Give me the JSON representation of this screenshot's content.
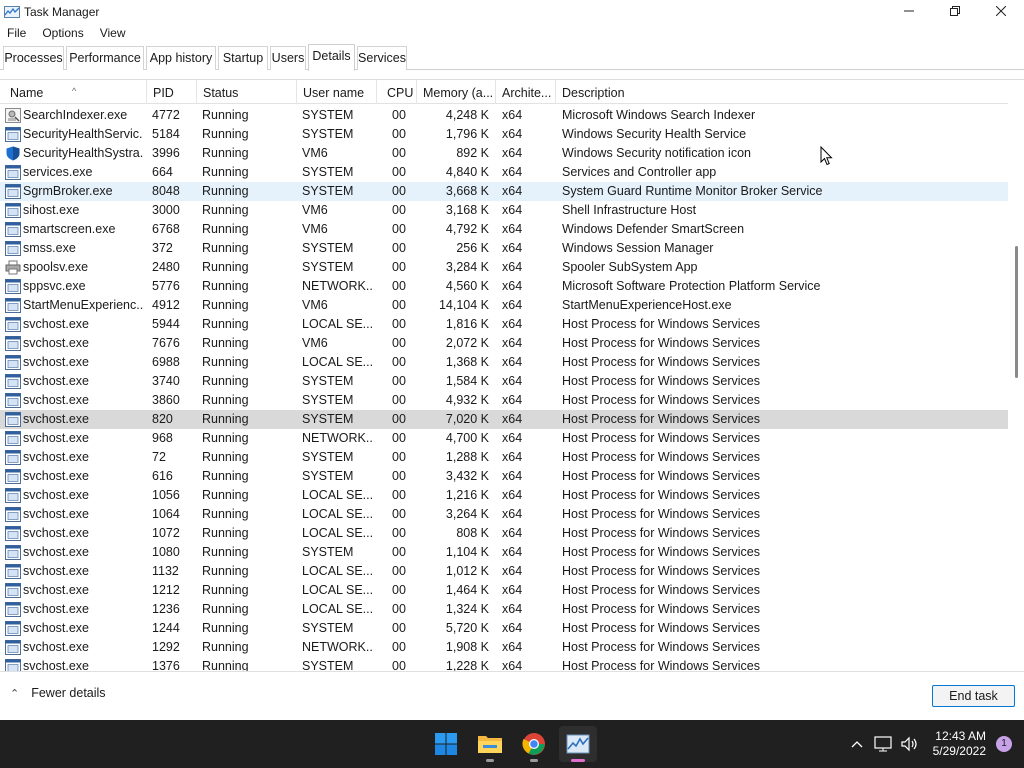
{
  "window": {
    "title": "Task Manager"
  },
  "menu": [
    "File",
    "Options",
    "View"
  ],
  "tabs": [
    {
      "label": "Processes",
      "active": false
    },
    {
      "label": "Performance",
      "active": false
    },
    {
      "label": "App history",
      "active": false
    },
    {
      "label": "Startup",
      "active": false
    },
    {
      "label": "Users",
      "active": false
    },
    {
      "label": "Details",
      "active": true
    },
    {
      "label": "Services",
      "active": false
    }
  ],
  "columns": {
    "name": "Name",
    "pid": "PID",
    "status": "Status",
    "user": "User name",
    "cpu": "CPU",
    "memory": "Memory (a...",
    "arch": "Archite...",
    "description": "Description"
  },
  "rows": [
    {
      "icon": "user-icon",
      "name": "SearchIndexer.exe",
      "pid": "4772",
      "status": "Running",
      "user": "SYSTEM",
      "cpu": "00",
      "mem": "4,248 K",
      "arch": "x64",
      "desc": "Microsoft Windows Search Indexer"
    },
    {
      "icon": "window-icon",
      "name": "SecurityHealthServic...",
      "pid": "5184",
      "status": "Running",
      "user": "SYSTEM",
      "cpu": "00",
      "mem": "1,796 K",
      "arch": "x64",
      "desc": "Windows Security Health Service"
    },
    {
      "icon": "shield-icon",
      "name": "SecurityHealthSystra...",
      "pid": "3996",
      "status": "Running",
      "user": "VM6",
      "cpu": "00",
      "mem": "892 K",
      "arch": "x64",
      "desc": "Windows Security notification icon"
    },
    {
      "icon": "window-icon",
      "name": "services.exe",
      "pid": "664",
      "status": "Running",
      "user": "SYSTEM",
      "cpu": "00",
      "mem": "4,840 K",
      "arch": "x64",
      "desc": "Services and Controller app"
    },
    {
      "icon": "window-icon",
      "name": "SgrmBroker.exe",
      "pid": "8048",
      "status": "Running",
      "user": "SYSTEM",
      "cpu": "00",
      "mem": "3,668 K",
      "arch": "x64",
      "desc": "System Guard Runtime Monitor Broker Service",
      "highlight": "blue"
    },
    {
      "icon": "window-icon",
      "name": "sihost.exe",
      "pid": "3000",
      "status": "Running",
      "user": "VM6",
      "cpu": "00",
      "mem": "3,168 K",
      "arch": "x64",
      "desc": "Shell Infrastructure Host"
    },
    {
      "icon": "window-icon",
      "name": "smartscreen.exe",
      "pid": "6768",
      "status": "Running",
      "user": "VM6",
      "cpu": "00",
      "mem": "4,792 K",
      "arch": "x64",
      "desc": "Windows Defender SmartScreen"
    },
    {
      "icon": "window-icon",
      "name": "smss.exe",
      "pid": "372",
      "status": "Running",
      "user": "SYSTEM",
      "cpu": "00",
      "mem": "256 K",
      "arch": "x64",
      "desc": "Windows Session Manager"
    },
    {
      "icon": "printer-icon",
      "name": "spoolsv.exe",
      "pid": "2480",
      "status": "Running",
      "user": "SYSTEM",
      "cpu": "00",
      "mem": "3,284 K",
      "arch": "x64",
      "desc": "Spooler SubSystem App"
    },
    {
      "icon": "window-icon",
      "name": "sppsvc.exe",
      "pid": "5776",
      "status": "Running",
      "user": "NETWORK...",
      "cpu": "00",
      "mem": "4,560 K",
      "arch": "x64",
      "desc": "Microsoft Software Protection Platform Service"
    },
    {
      "icon": "window-icon",
      "name": "StartMenuExperienc...",
      "pid": "4912",
      "status": "Running",
      "user": "VM6",
      "cpu": "00",
      "mem": "14,104 K",
      "arch": "x64",
      "desc": "StartMenuExperienceHost.exe"
    },
    {
      "icon": "window-icon",
      "name": "svchost.exe",
      "pid": "5944",
      "status": "Running",
      "user": "LOCAL SE...",
      "cpu": "00",
      "mem": "1,816 K",
      "arch": "x64",
      "desc": "Host Process for Windows Services"
    },
    {
      "icon": "window-icon",
      "name": "svchost.exe",
      "pid": "7676",
      "status": "Running",
      "user": "VM6",
      "cpu": "00",
      "mem": "2,072 K",
      "arch": "x64",
      "desc": "Host Process for Windows Services"
    },
    {
      "icon": "window-icon",
      "name": "svchost.exe",
      "pid": "6988",
      "status": "Running",
      "user": "LOCAL SE...",
      "cpu": "00",
      "mem": "1,368 K",
      "arch": "x64",
      "desc": "Host Process for Windows Services"
    },
    {
      "icon": "window-icon",
      "name": "svchost.exe",
      "pid": "3740",
      "status": "Running",
      "user": "SYSTEM",
      "cpu": "00",
      "mem": "1,584 K",
      "arch": "x64",
      "desc": "Host Process for Windows Services"
    },
    {
      "icon": "window-icon",
      "name": "svchost.exe",
      "pid": "3860",
      "status": "Running",
      "user": "SYSTEM",
      "cpu": "00",
      "mem": "4,932 K",
      "arch": "x64",
      "desc": "Host Process for Windows Services"
    },
    {
      "icon": "window-icon",
      "name": "svchost.exe",
      "pid": "820",
      "status": "Running",
      "user": "SYSTEM",
      "cpu": "00",
      "mem": "7,020 K",
      "arch": "x64",
      "desc": "Host Process for Windows Services",
      "highlight": "grey"
    },
    {
      "icon": "window-icon",
      "name": "svchost.exe",
      "pid": "968",
      "status": "Running",
      "user": "NETWORK...",
      "cpu": "00",
      "mem": "4,700 K",
      "arch": "x64",
      "desc": "Host Process for Windows Services"
    },
    {
      "icon": "window-icon",
      "name": "svchost.exe",
      "pid": "72",
      "status": "Running",
      "user": "SYSTEM",
      "cpu": "00",
      "mem": "1,288 K",
      "arch": "x64",
      "desc": "Host Process for Windows Services"
    },
    {
      "icon": "window-icon",
      "name": "svchost.exe",
      "pid": "616",
      "status": "Running",
      "user": "SYSTEM",
      "cpu": "00",
      "mem": "3,432 K",
      "arch": "x64",
      "desc": "Host Process for Windows Services"
    },
    {
      "icon": "window-icon",
      "name": "svchost.exe",
      "pid": "1056",
      "status": "Running",
      "user": "LOCAL SE...",
      "cpu": "00",
      "mem": "1,216 K",
      "arch": "x64",
      "desc": "Host Process for Windows Services"
    },
    {
      "icon": "window-icon",
      "name": "svchost.exe",
      "pid": "1064",
      "status": "Running",
      "user": "LOCAL SE...",
      "cpu": "00",
      "mem": "3,264 K",
      "arch": "x64",
      "desc": "Host Process for Windows Services"
    },
    {
      "icon": "window-icon",
      "name": "svchost.exe",
      "pid": "1072",
      "status": "Running",
      "user": "LOCAL SE...",
      "cpu": "00",
      "mem": "808 K",
      "arch": "x64",
      "desc": "Host Process for Windows Services"
    },
    {
      "icon": "window-icon",
      "name": "svchost.exe",
      "pid": "1080",
      "status": "Running",
      "user": "SYSTEM",
      "cpu": "00",
      "mem": "1,104 K",
      "arch": "x64",
      "desc": "Host Process for Windows Services"
    },
    {
      "icon": "window-icon",
      "name": "svchost.exe",
      "pid": "1132",
      "status": "Running",
      "user": "LOCAL SE...",
      "cpu": "00",
      "mem": "1,012 K",
      "arch": "x64",
      "desc": "Host Process for Windows Services"
    },
    {
      "icon": "window-icon",
      "name": "svchost.exe",
      "pid": "1212",
      "status": "Running",
      "user": "LOCAL SE...",
      "cpu": "00",
      "mem": "1,464 K",
      "arch": "x64",
      "desc": "Host Process for Windows Services"
    },
    {
      "icon": "window-icon",
      "name": "svchost.exe",
      "pid": "1236",
      "status": "Running",
      "user": "LOCAL SE...",
      "cpu": "00",
      "mem": "1,324 K",
      "arch": "x64",
      "desc": "Host Process for Windows Services"
    },
    {
      "icon": "window-icon",
      "name": "svchost.exe",
      "pid": "1244",
      "status": "Running",
      "user": "SYSTEM",
      "cpu": "00",
      "mem": "5,720 K",
      "arch": "x64",
      "desc": "Host Process for Windows Services"
    },
    {
      "icon": "window-icon",
      "name": "svchost.exe",
      "pid": "1292",
      "status": "Running",
      "user": "NETWORK...",
      "cpu": "00",
      "mem": "1,908 K",
      "arch": "x64",
      "desc": "Host Process for Windows Services"
    },
    {
      "icon": "window-icon",
      "name": "svchost.exe",
      "pid": "1376",
      "status": "Running",
      "user": "SYSTEM",
      "cpu": "00",
      "mem": "1,228 K",
      "arch": "x64",
      "desc": "Host Process for Windows Services"
    }
  ],
  "footer": {
    "fewer_details": "Fewer details",
    "end_task": "End task"
  },
  "taskbar": {
    "apps": [
      "windows-start-icon",
      "file-explorer-icon",
      "chrome-icon",
      "task-manager-icon"
    ],
    "time": "12:43 AM",
    "date": "5/29/2022",
    "notification_count": "1"
  },
  "colors": {
    "accent": "#0078d4",
    "row_selected": "#e5f1fb",
    "row_hover": "#d9d9d9",
    "taskbar": "#202020"
  }
}
